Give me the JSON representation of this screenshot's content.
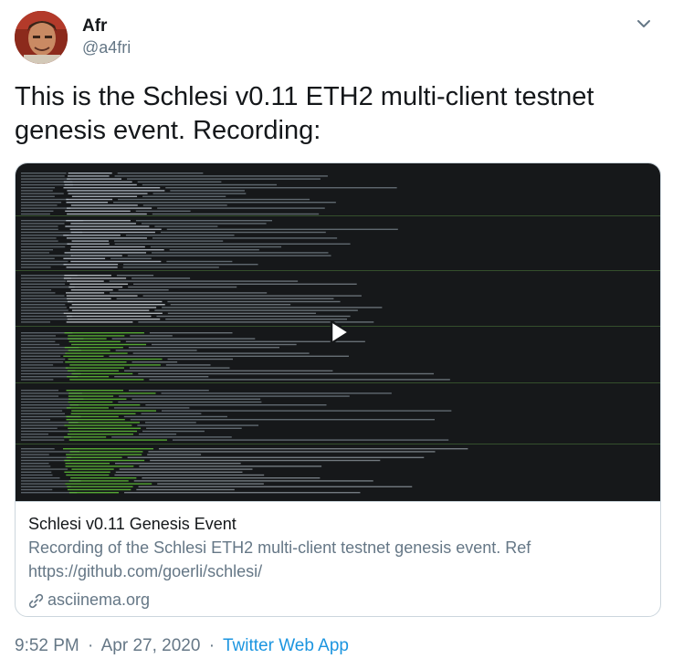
{
  "author": {
    "display_name": "Afr",
    "handle": "@a4fri",
    "avatar_icon": "user-avatar-photo"
  },
  "menu_icon": "chevron-down-icon",
  "tweet": {
    "text": "This is the Schlesi v0.11 ETH2 multi-client testnet genesis event. Recording:"
  },
  "card": {
    "media_icon": "play-icon",
    "title": "Schlesi v0.11 Genesis Event",
    "description": "Recording of the Schlesi ETH2 multi-client testnet genesis event. Ref https://github.com/goerli/schlesi/",
    "domain": "asciinema.org",
    "domain_icon": "link-icon"
  },
  "meta": {
    "time": "9:52 PM",
    "separator": "·",
    "date": "Apr 27, 2020",
    "source": "Twitter Web App"
  },
  "colors": {
    "text_primary": "#14171a",
    "text_secondary": "#657786",
    "link": "#1b95e0",
    "border": "#ccd6dd",
    "terminal_bg": "#16181a",
    "terminal_green": "#5fbf3a"
  }
}
